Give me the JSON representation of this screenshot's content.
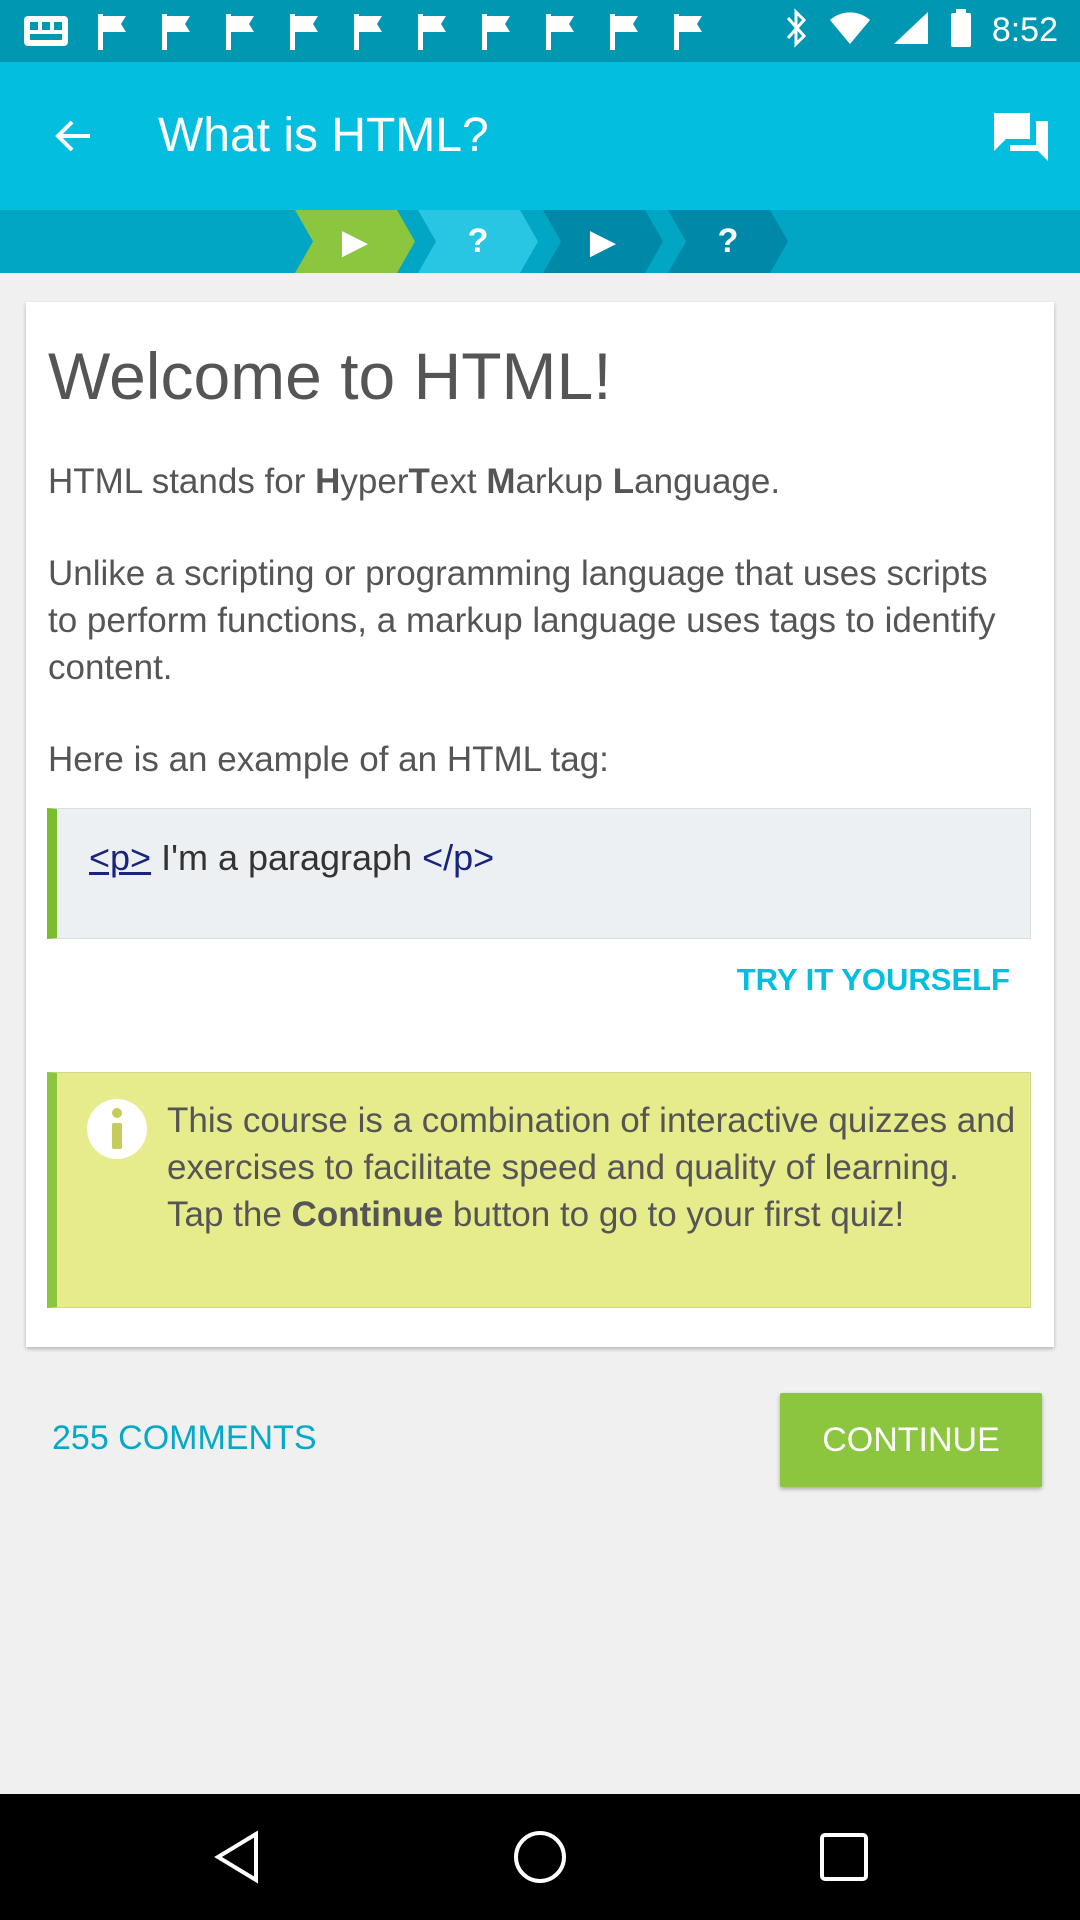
{
  "status_bar": {
    "time": "8:52",
    "notification_icons": [
      "gallery-icon",
      "flag-icon",
      "flag-icon",
      "flag-icon",
      "flag-icon",
      "flag-icon",
      "flag-icon",
      "flag-icon",
      "flag-icon",
      "flag-icon",
      "flag-icon"
    ],
    "status_icons": [
      "bluetooth-icon",
      "wifi-icon",
      "signal-icon",
      "battery-icon"
    ]
  },
  "app_bar": {
    "title": "What is HTML?"
  },
  "progress_steps": [
    {
      "type": "lesson",
      "glyph": "▶",
      "state": "active"
    },
    {
      "type": "quiz",
      "glyph": "?",
      "state": "upcoming"
    },
    {
      "type": "lesson",
      "glyph": "▶",
      "state": "upcoming"
    },
    {
      "type": "quiz",
      "glyph": "?",
      "state": "upcoming"
    }
  ],
  "lesson": {
    "title": "Welcome to HTML!",
    "intro": {
      "prefix": "HTML stands for ",
      "h": "H",
      "yper": "yper",
      "t": "T",
      "ext": "ext ",
      "m": "M",
      "arkup": "arkup ",
      "l": "L",
      "anguage": "anguage."
    },
    "paragraph2": "Unlike a scripting or programming language that uses scripts to perform functions, a markup language uses tags to identify content.",
    "paragraph3": "Here is an example of an HTML tag:",
    "code": {
      "open_tag": "<p>",
      "content": " I'm a paragraph ",
      "close_tag": "</p>"
    },
    "try_it_label": "TRY IT YOURSELF",
    "info": {
      "line1": "This course is a combination of interactive quizzes and exercises to facilitate speed and quality of learning.",
      "line2_prefix": "Tap the ",
      "line2_bold": "Continue",
      "line2_suffix": " button to go to your first quiz!"
    }
  },
  "footer": {
    "comments_label": "255 COMMENTS",
    "continue_label": "CONTINUE"
  },
  "colors": {
    "app_bar": "#03bedf",
    "status_bar": "#0097b2",
    "accent_green": "#8cc63e",
    "info_background": "#e6eb8b",
    "link": "#03bedf"
  }
}
